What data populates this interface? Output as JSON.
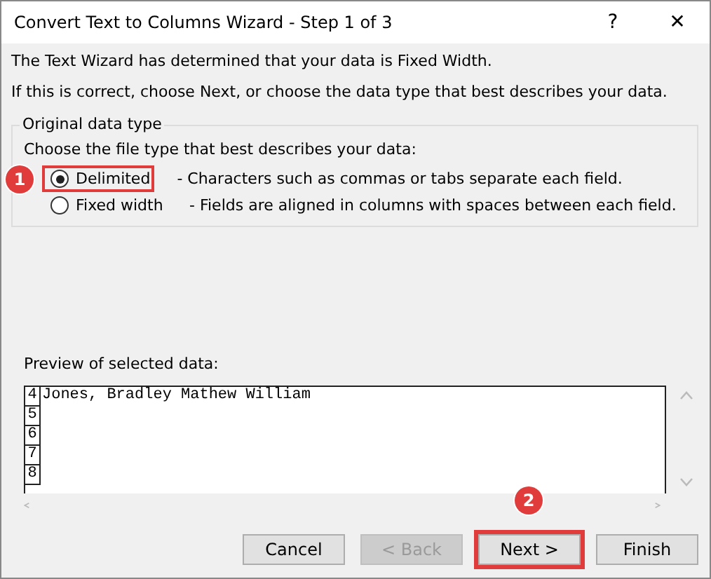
{
  "window": {
    "title": "Convert Text to Columns Wizard - Step 1 of 3",
    "help": "?",
    "close": "✕"
  },
  "intro": [
    "The Text Wizard has determined that your data is Fixed Width.",
    "If this is correct, choose Next, or choose the data type that best describes your data."
  ],
  "group": {
    "title": "Original data type",
    "prompt": "Choose the file type that best describes your data:",
    "options": [
      {
        "label": "Delimited",
        "description": "- Characters such as commas or tabs separate each field.",
        "selected": true,
        "callout": "1"
      },
      {
        "label": "Fixed width",
        "description": "- Fields are aligned in columns with spaces between each field.",
        "selected": false
      }
    ]
  },
  "preview": {
    "label": "Preview of selected data:",
    "rows": [
      {
        "number": "4",
        "text": "Jones, Bradley Mathew William"
      },
      {
        "number": "5",
        "text": ""
      },
      {
        "number": "6",
        "text": ""
      },
      {
        "number": "7",
        "text": ""
      },
      {
        "number": "8",
        "text": ""
      }
    ]
  },
  "buttons": [
    {
      "label": "Cancel",
      "disabled": false
    },
    {
      "label": "< Back",
      "disabled": true
    },
    {
      "label": "Next >",
      "disabled": false,
      "callout": "2"
    },
    {
      "label": "Finish",
      "disabled": false
    }
  ]
}
